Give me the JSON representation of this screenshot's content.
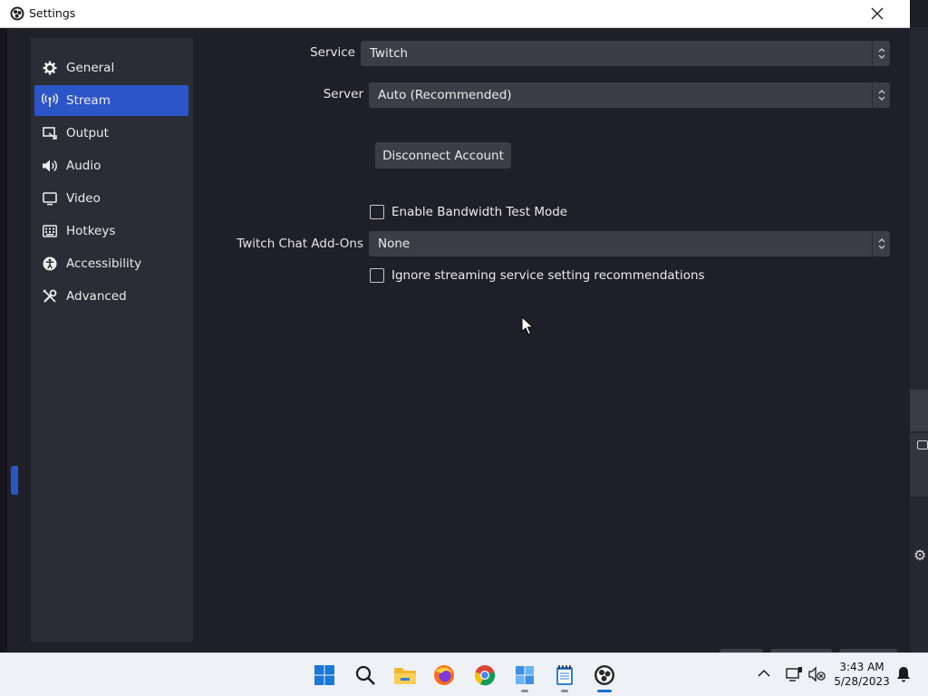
{
  "window": {
    "title": "Settings"
  },
  "sidebar": {
    "items": [
      {
        "label": "General",
        "icon": "gear-icon"
      },
      {
        "label": "Stream",
        "icon": "antenna-icon",
        "active": true
      },
      {
        "label": "Output",
        "icon": "output-icon"
      },
      {
        "label": "Audio",
        "icon": "speaker-icon"
      },
      {
        "label": "Video",
        "icon": "monitor-icon"
      },
      {
        "label": "Hotkeys",
        "icon": "keyboard-icon"
      },
      {
        "label": "Accessibility",
        "icon": "accessibility-icon"
      },
      {
        "label": "Advanced",
        "icon": "tools-icon"
      }
    ]
  },
  "stream": {
    "service_label": "Service",
    "service_value": "Twitch",
    "server_label": "Server",
    "server_value": "Auto (Recommended)",
    "disconnect_label": "Disconnect Account",
    "bandwidth_label": "Enable Bandwidth Test Mode",
    "bandwidth_checked": false,
    "chat_addons_label": "Twitch Chat Add-Ons",
    "chat_addons_value": "None",
    "ignore_recs_label": "Ignore streaming service setting recommendations",
    "ignore_recs_checked": false
  },
  "taskbar": {
    "apps": [
      "windows-start-icon",
      "search-icon",
      "file-explorer-icon",
      "firefox-icon",
      "chrome-icon",
      "control-panel-icon",
      "notepad-icon",
      "obs-icon"
    ],
    "time": "3:43 AM",
    "date": "5/28/2023"
  },
  "colors": {
    "accent": "#2c55c7",
    "panel": "#2a2c36",
    "background": "#1e1f29",
    "control": "#3b3d47"
  }
}
